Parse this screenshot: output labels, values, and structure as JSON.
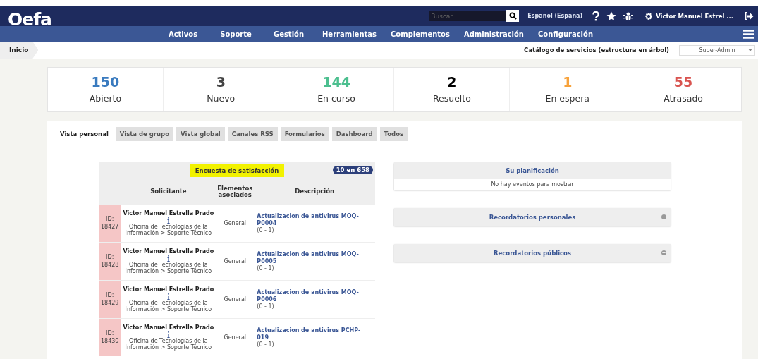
{
  "header": {
    "logo": "Oefa",
    "search": {
      "placeholder": "Buscar"
    },
    "language": "Español (España)",
    "user": "Victor Manuel Estrel ...",
    "nav": [
      "Activos",
      "Soporte",
      "Gestión",
      "Herramientas",
      "Complementos",
      "Administración",
      "Configuración"
    ]
  },
  "breadcrumb": {
    "items": [
      "Inicio"
    ],
    "catalog_link": "Catálogo de servicios (estructura en árbol)",
    "profile": "Super-Admin"
  },
  "stats": [
    {
      "value": "150",
      "label": "Abierto",
      "color": "#3a7bbf"
    },
    {
      "value": "3",
      "label": "Nuevo",
      "color": "#444444"
    },
    {
      "value": "144",
      "label": "En curso",
      "color": "#4cbf8f"
    },
    {
      "value": "2",
      "label": "Resuelto",
      "color": "#000000"
    },
    {
      "value": "1",
      "label": "En espera",
      "color": "#f7a23b"
    },
    {
      "value": "55",
      "label": "Atrasado",
      "color": "#d9534f"
    }
  ],
  "tabs": [
    {
      "label": "Vista personal",
      "selected": true
    },
    {
      "label": "Vista de grupo",
      "selected": false
    },
    {
      "label": "Vista global",
      "selected": false
    },
    {
      "label": "Canales RSS",
      "selected": false
    },
    {
      "label": "Formularios",
      "selected": false
    },
    {
      "label": "Dashboard",
      "selected": false
    },
    {
      "label": "Todos",
      "selected": false
    }
  ],
  "survey": {
    "title": "Encuesta de satisfacción",
    "highlighted": true,
    "count": "10 en 658",
    "columns": [
      "Solicitante",
      "Elementos asociados",
      "Descripción"
    ],
    "rows": [
      {
        "id": "ID: 18427",
        "requester": "Victor Manuel Estrella Prado",
        "department": "Oficina de Tecnologías de la Información > Soporte Técnico",
        "items": "General",
        "link": "Actualizacion de antivirus MOQ-P0004",
        "suffix": "(0 - 1)"
      },
      {
        "id": "ID: 18428",
        "requester": "Victor Manuel Estrella Prado",
        "department": "Oficina de Tecnologías de la Información > Soporte Técnico",
        "items": "General",
        "link": "Actualizacion de antivirus MOQ-P0005",
        "suffix": "(0 - 1)"
      },
      {
        "id": "ID: 18429",
        "requester": "Victor Manuel Estrella Prado",
        "department": "Oficina de Tecnologías de la Información > Soporte Técnico",
        "items": "General",
        "link": "Actualizacion de antivirus MOQ-P0006",
        "suffix": "(0 - 1)"
      },
      {
        "id": "ID: 18430",
        "requester": "Victor Manuel Estrella Prado",
        "department": "Oficina de Tecnologías de la Información > Soporte Técnico",
        "items": "General",
        "link": "Actualizacion de antivirus PCHP-019",
        "suffix": "(0 - 1)"
      }
    ]
  },
  "planning": {
    "title": "Su planificación",
    "empty_text": "No hay eventos para mostrar"
  },
  "reminders": [
    {
      "title": "Recordatorios personales"
    },
    {
      "title": "Recordatorios públicos"
    }
  ]
}
